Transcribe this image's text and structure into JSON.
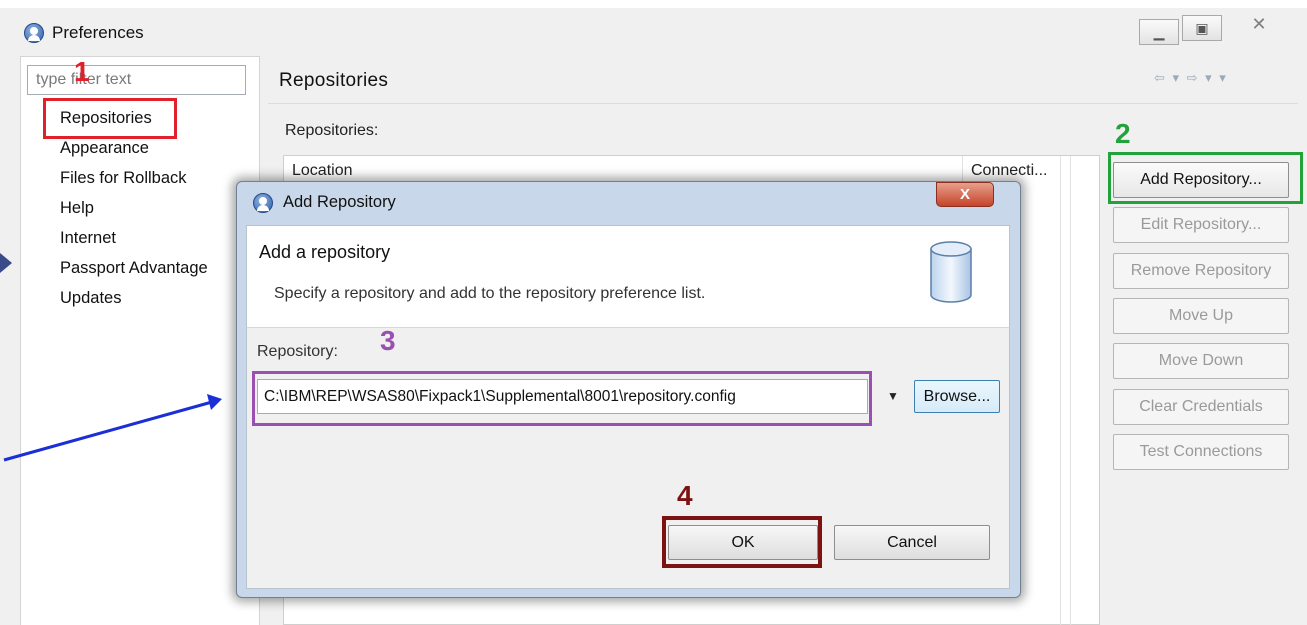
{
  "window": {
    "title": "Preferences"
  },
  "left_nav": {
    "filter_placeholder": "type filter text",
    "items": [
      "Repositories",
      "Appearance",
      "Files for Rollback",
      "Help",
      "Internet",
      "Passport Advantage",
      "Updates"
    ]
  },
  "main": {
    "title": "Repositories",
    "nav_arrows": "⇦ ▾ ⇨ ▾ ▾",
    "sub_label": "Repositories:",
    "columns": [
      "Location",
      "Connecti..."
    ],
    "buttons": [
      "Add Repository...",
      "Edit Repository...",
      "Remove Repository",
      "Move Up",
      "Move Down",
      "Clear Credentials",
      "Test Connections"
    ]
  },
  "dialog": {
    "title": "Add Repository",
    "heading": "Add a repository",
    "description": "Specify a repository and add to the repository preference list.",
    "repo_label": "Repository:",
    "repo_value": "C:\\IBM\\REP\\WSAS80\\Fixpack1\\Supplemental\\8001\\repository.config",
    "browse_label": "Browse...",
    "ok_label": "OK",
    "cancel_label": "Cancel",
    "close_glyph": "X"
  },
  "annotations": {
    "step1": "1",
    "step2": "2",
    "step3": "3",
    "step4": "4",
    "colors": {
      "step1": "#e0202a",
      "step2": "#22a23a",
      "step3": "#9b4fb0",
      "step4": "#7d1212",
      "arrow": "#1a2fd6"
    }
  },
  "icons": [
    "preferences-app-icon",
    "repository-cylinder-icon",
    "close-icon",
    "minimize-icon",
    "maximize-icon",
    "dropdown-arrow-icon"
  ]
}
